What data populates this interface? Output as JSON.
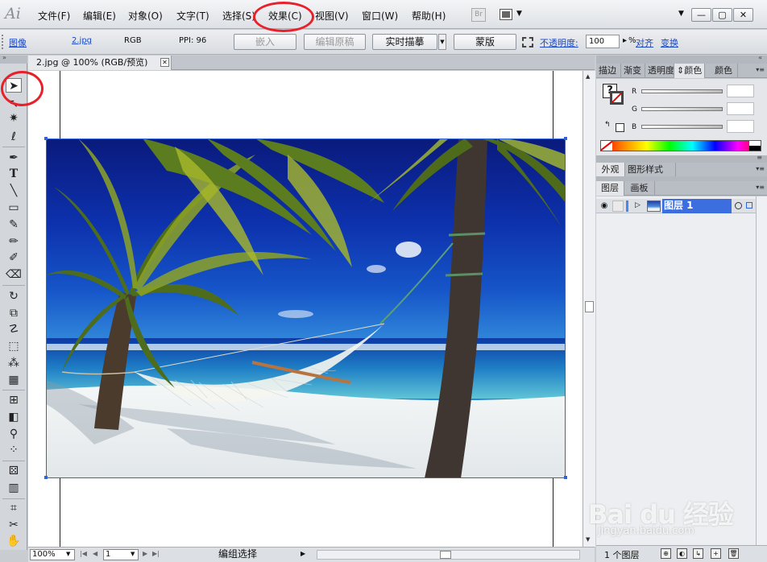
{
  "app": {
    "logo_text": "Ai"
  },
  "menu": {
    "items": [
      "文件(F)",
      "编辑(E)",
      "对象(O)",
      "文字(T)",
      "选择(S)",
      "效果(C)",
      "视图(V)",
      "窗口(W)",
      "帮助(H)"
    ],
    "bridge_label": "Br"
  },
  "window_controls": {
    "minimize": "—",
    "restore": "▢",
    "close": "✕"
  },
  "control_bar": {
    "object_type": "图像",
    "file_name": "2.jpg",
    "color_mode": "RGB",
    "ppi": "PPI: 96",
    "embed_label": "嵌入",
    "edit_original_label": "编辑原稿",
    "live_trace_label": "实时描摹",
    "mask_label": "蒙版",
    "opacity_label": "不透明度:",
    "opacity_value": "100",
    "opacity_unit": "%",
    "align_label": "对齐",
    "transform_label": "变换"
  },
  "document": {
    "tab_title": "2.jpg @ 100% (RGB/预览)",
    "close_glyph": "✕"
  },
  "statusbar": {
    "zoom": "100%",
    "page": "1",
    "status_text": "编组选择"
  },
  "panels": {
    "color_tabs": [
      "描边",
      "渐变",
      "透明度",
      "颜色",
      "颜色"
    ],
    "color_channels": [
      "R",
      "G",
      "B"
    ],
    "appearance_tabs": [
      "外观",
      "图形样式"
    ],
    "layer_tabs": [
      "图层",
      "画板"
    ],
    "layers": [
      {
        "name": "图层 1"
      }
    ],
    "layer_count": "1 个图层"
  },
  "watermark": {
    "main": "Bai du 经验",
    "sub": "jingyan.baidu.com"
  },
  "colors": {
    "annotation_red": "#e8202a",
    "selection_blue": "#2f63d9",
    "link_blue": "#1a48c7",
    "layer_highlight": "#3d6ee0"
  }
}
